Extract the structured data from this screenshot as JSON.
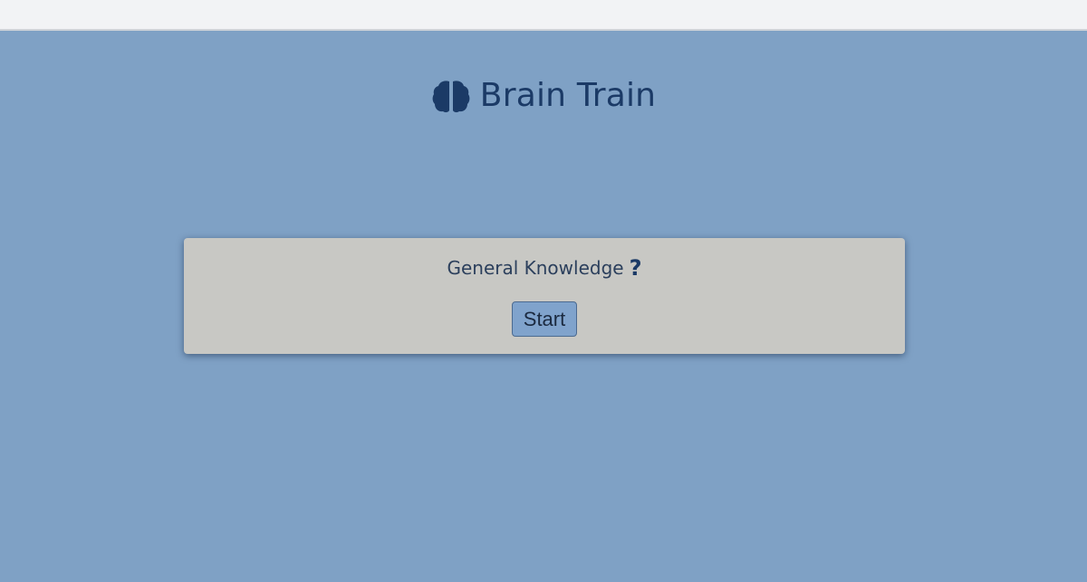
{
  "header": {
    "icon": "brain-icon",
    "title": "Brain Train"
  },
  "quiz": {
    "category_label": "General Knowledge",
    "category_icon": "question-icon",
    "start_label": "Start"
  },
  "colors": {
    "background": "#7fa1c5",
    "card": "#c8c8c4",
    "brand": "#1b3a66",
    "button": "#80a3cc"
  }
}
